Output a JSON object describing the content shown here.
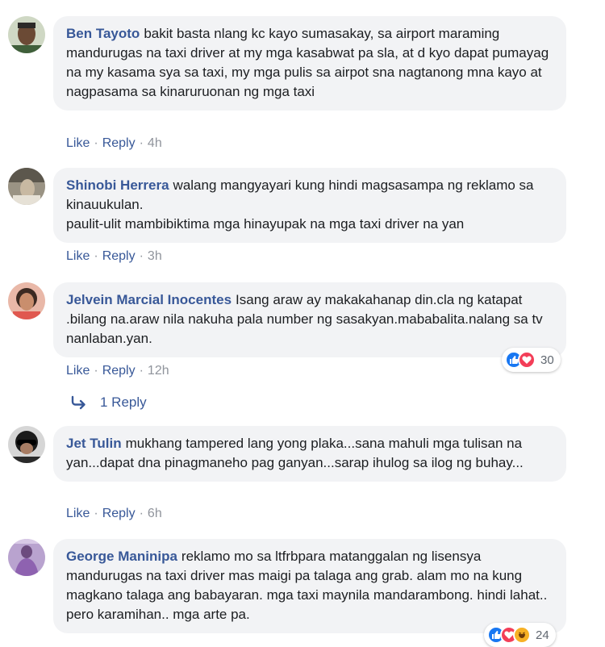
{
  "colors": {
    "name": "#385898",
    "bubble": "#f2f3f5",
    "meta": "#90949c",
    "like": "#1877f2",
    "love": "#f33e58",
    "haha": "#f7b125"
  },
  "actions": {
    "like_label": "Like",
    "reply_label": "Reply",
    "separator": "·"
  },
  "comments": [
    {
      "author": "Ben Tayoto",
      "text": "bakit basta nlang kc kayo sumasakay, sa airport maraming mandurugas na taxi driver at my mga kasabwat pa sla, at d kyo dapat pumayag na my kasama sya sa taxi, my mga pulis sa airpot sna nagtanong mna kayo at nagpasama sa kinaruruonan ng mga taxi",
      "time": "4h"
    },
    {
      "author": "Shinobi Herrera",
      "text": "walang mangyayari kung hindi magsasampa ng reklamo sa kinauukulan.",
      "text2": "paulit-ulit mambibiktima mga hinayupak na mga taxi driver na yan",
      "time": "3h"
    },
    {
      "author": "Jelvein Marcial Inocentes",
      "text": "Isang araw ay makakahanap din.cla ng katapat .bilang na.araw nila nakuha pala number ng sasakyan.mababalita.nalang sa tv nanlaban.yan.",
      "time": "12h",
      "reactions": {
        "icons": [
          "like-icon",
          "love-icon"
        ],
        "count": "30"
      },
      "replies_label": "1 Reply"
    },
    {
      "author": "Jet Tulin",
      "text": "mukhang tampered lang yong plaka...sana mahuli mga tulisan na yan...dapat dna pinagmaneho pag ganyan...sarap ihulog sa ilog ng buhay...",
      "time": "6h"
    },
    {
      "author": "George Maninipa",
      "text": "reklamo mo sa ltfrbpara matanggalan ng lisensya mandurugas na taxi driver mas maigi pa talaga ang grab. alam mo na kung magkano talaga ang babayaran. mga taxi maynila mandarambong. hindi lahat.. pero karamihan.. mga arte pa.",
      "reactions": {
        "icons": [
          "like-icon",
          "love-icon",
          "haha-icon"
        ],
        "count": "24"
      }
    }
  ]
}
